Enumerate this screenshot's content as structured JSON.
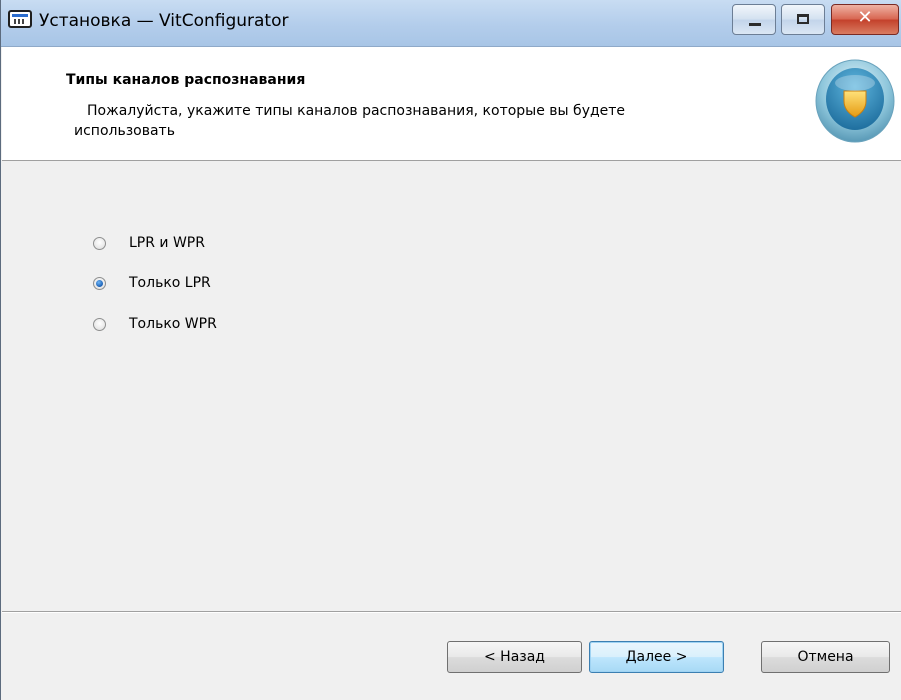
{
  "window": {
    "title": "Установка — VitConfigurator",
    "icon": "installer-window-icon",
    "controls": {
      "minimize": "minimize-icon",
      "maximize": "maximize-icon",
      "close_glyph": "✕"
    }
  },
  "header": {
    "title": "Типы каналов распознавания",
    "description_line1": "Пожалуйста, укажите типы каналов распознавания, которые вы будете",
    "description_line2": "использовать",
    "logo": "shield-logo-icon"
  },
  "options": {
    "selected_index": 1,
    "items": [
      {
        "label": "LPR и WPR",
        "checked": false
      },
      {
        "label": "Только LPR",
        "checked": true
      },
      {
        "label": "Только WPR",
        "checked": false
      }
    ]
  },
  "buttons": {
    "back": "< Назад",
    "next": "Далее >",
    "cancel": "Отмена"
  },
  "colors": {
    "titlebar": "#b3cdeb",
    "close_button": "#c3402a",
    "radio_selected": "#1a5fb4",
    "dialog_background": "#f0f0f0"
  }
}
